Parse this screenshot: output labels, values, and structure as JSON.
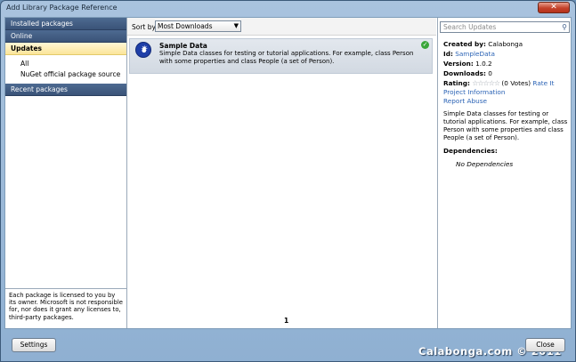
{
  "window": {
    "title": "Add Library Package Reference"
  },
  "nav": {
    "installed": "Installed packages",
    "online": "Online",
    "updates": "Updates",
    "sub_items": [
      "All",
      "NuGet official package source"
    ],
    "recent": "Recent packages",
    "license": "Each package is licensed to you by its owner. Microsoft is not responsible for, nor does it grant any licenses to, third-party packages."
  },
  "sort": {
    "label": "Sort by:",
    "value": "Most Downloads"
  },
  "packages": [
    {
      "name": "Sample Data",
      "description": "Simple Data classes for testing or tutorial applications. For example, class Person with some properties and class People (a set of Person)."
    }
  ],
  "pager": {
    "page": "1"
  },
  "search": {
    "placeholder": "Search Updates"
  },
  "detail": {
    "created_by_label": "Created by:",
    "created_by": "Calabonga",
    "id_label": "Id:",
    "id": "SampleData",
    "version_label": "Version:",
    "version": "1.0.2",
    "downloads_label": "Downloads:",
    "downloads": "0",
    "rating_label": "Rating:",
    "stars": "☆☆☆☆☆",
    "votes": "(0 Votes)",
    "rate_it": "Rate It",
    "project_info": "Project Information",
    "report_abuse": "Report Abuse",
    "description": "Simple Data classes for testing or tutorial applications. For example, class Person with some properties and class People (a set of Person).",
    "dependencies_label": "Dependencies:",
    "dependencies": "No Dependencies"
  },
  "buttons": {
    "settings": "Settings",
    "close": "Close"
  },
  "watermark": "Calabonga.com © 2011",
  "colors": {
    "nav_header": "#3f5b83",
    "selected": "#fbe59a",
    "link": "#2b63b5",
    "frame": "#8fb0d2"
  }
}
